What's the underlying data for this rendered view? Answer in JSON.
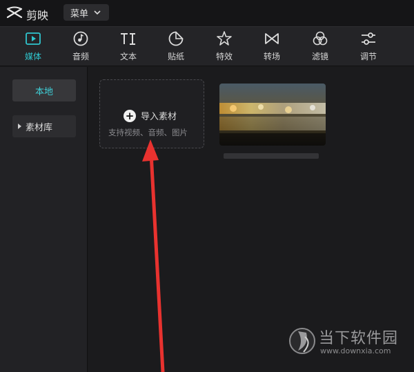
{
  "app": {
    "name": "剪映",
    "menu_label": "菜单"
  },
  "toolbar": [
    {
      "label": "媒体",
      "icon": "media-icon",
      "active": true
    },
    {
      "label": "音频",
      "icon": "audio-icon",
      "active": false
    },
    {
      "label": "文本",
      "icon": "text-icon",
      "active": false
    },
    {
      "label": "贴纸",
      "icon": "sticker-icon",
      "active": false
    },
    {
      "label": "特效",
      "icon": "effects-icon",
      "active": false
    },
    {
      "label": "转场",
      "icon": "transition-icon",
      "active": false
    },
    {
      "label": "滤镜",
      "icon": "filter-icon",
      "active": false
    },
    {
      "label": "调节",
      "icon": "adjust-icon",
      "active": false
    }
  ],
  "sidebar": {
    "local": "本地",
    "library": "素材库"
  },
  "import": {
    "label": "导入素材",
    "hint": "支持视频、音频、图片"
  },
  "watermark": {
    "title": "当下软件园",
    "url": "www.downxia.com"
  },
  "colors": {
    "accent": "#2fc6cf",
    "arrow": "#e8322f",
    "panel": "#222225",
    "background": "#1b1b1d"
  }
}
